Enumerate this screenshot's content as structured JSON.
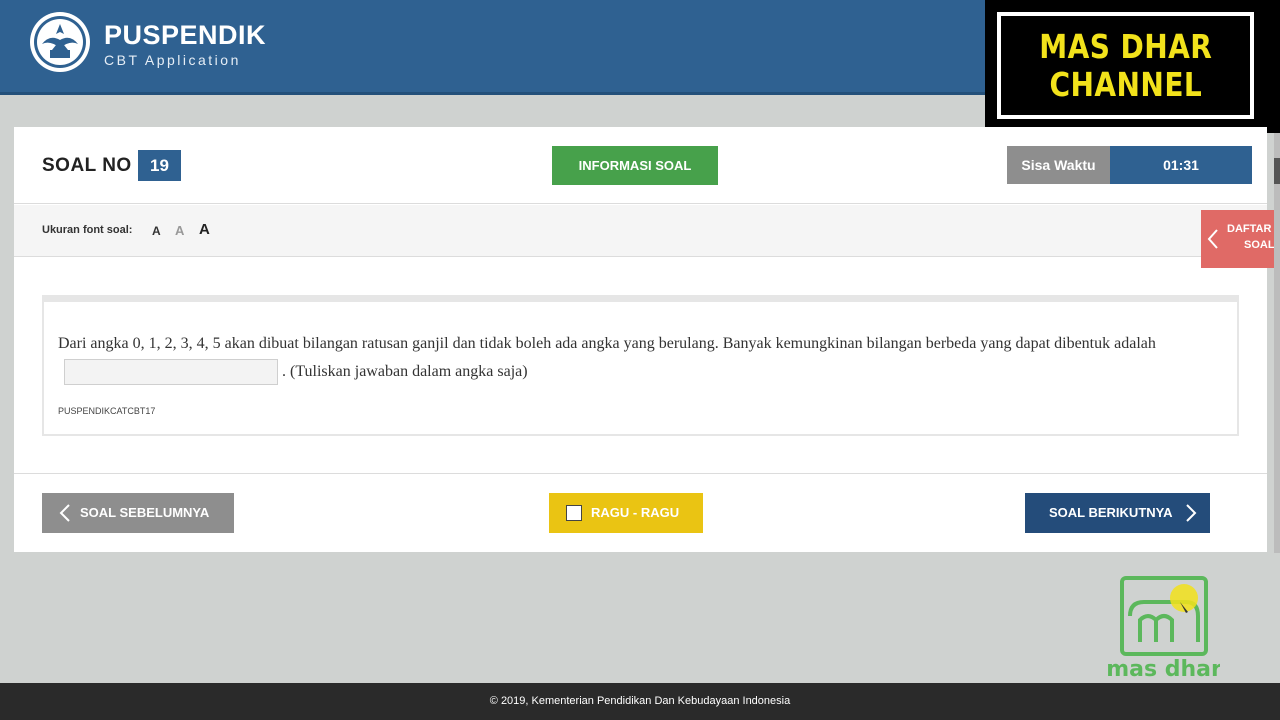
{
  "header": {
    "title": "PUSPENDIK",
    "subtitle": "CBT Application"
  },
  "watermark": {
    "line1": "MAS DHAR",
    "line2": "CHANNEL"
  },
  "question_bar": {
    "label": "SOAL NO",
    "number": "19",
    "info_button": "INFORMASI SOAL",
    "timer_label": "Sisa Waktu",
    "timer_value": "01:31"
  },
  "font_bar": {
    "label": "Ukuran font soal:",
    "small": "A",
    "medium": "A",
    "large": "A"
  },
  "side_tab": {
    "line1": "DAFTAR",
    "line2": "SOAL"
  },
  "question": {
    "text_before": "Dari angka 0, 1, 2, 3, 4, 5 akan dibuat bilangan ratusan ganjil dan tidak boleh ada angka yang berulang. Banyak kemungkinan bilangan berbeda yang dapat dibentuk adalah",
    "answer_value": "",
    "text_after": ".  (Tuliskan jawaban dalam angka saja)",
    "code": "PUSPENDIKCATCBT17"
  },
  "navigation": {
    "prev": "SOAL SEBELUMNYA",
    "ragu": "RAGU - RAGU",
    "next": "SOAL BERIKUTNYA"
  },
  "brand_logo": {
    "text": "mas dhar"
  },
  "footer": {
    "text": "© 2019, Kementerian Pendidikan Dan Kebudayaan Indonesia"
  },
  "colors": {
    "header": "#2f6191",
    "info_button": "#47a14b",
    "ragu_button": "#eac413",
    "next_button": "#244c7a",
    "side_tab": "#e06a66",
    "watermark_text": "#f2e21b"
  }
}
